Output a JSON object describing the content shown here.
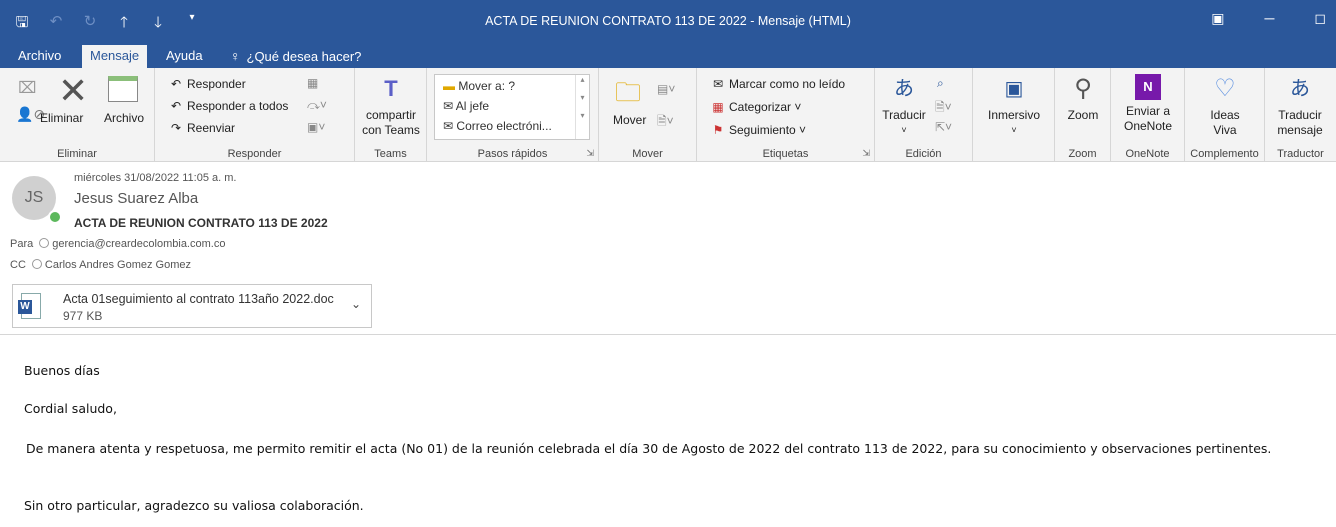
{
  "titlebar": {
    "title": "ACTA DE REUNION CONTRATO 113 DE 2022  -  Mensaje (HTML)",
    "qat": [
      "save-icon",
      "undo-icon",
      "redo-icon",
      "arrow-up-icon",
      "arrow-down-icon",
      "customize-icon"
    ]
  },
  "tabs": {
    "archivo": "Archivo",
    "mensaje": "Mensaje",
    "ayuda": "Ayuda",
    "search": "¿Qué desea hacer?"
  },
  "ribbon": {
    "eliminar": {
      "label": "Eliminar",
      "eliminar_btn": "Eliminar",
      "archivo_btn": "Archivo"
    },
    "responder": {
      "label": "Responder",
      "responder": "Responder",
      "responder_todos": "Responder a todos",
      "reenviar": "Reenviar"
    },
    "teams": {
      "label": "Teams",
      "compartir_line1": "compartir",
      "compartir_line2": "con Teams"
    },
    "pasos": {
      "label": "Pasos rápidos",
      "item1": "Mover a: ?",
      "item2": "Al jefe",
      "item3": "Correo electróni..."
    },
    "mover": {
      "label": "Mover",
      "mover_btn": "Mover"
    },
    "etiquetas": {
      "label": "Etiquetas",
      "marcar": "Marcar como no leído",
      "categorizar": "Categorizar",
      "seguimiento": "Seguimiento"
    },
    "edicion": {
      "label": "Edición",
      "traducir": "Traducir"
    },
    "inmersivo": {
      "label": "",
      "btn": "Inmersivo"
    },
    "zoom": {
      "label": "Zoom",
      "btn": "Zoom"
    },
    "onenote": {
      "label": "OneNote",
      "line1": "Enviar a",
      "line2": "OneNote"
    },
    "complemento": {
      "label": "Complemento",
      "line1": "Ideas",
      "line2": "Viva"
    },
    "traductor": {
      "label": "Traductor",
      "line1": "Traducir",
      "line2": "mensaje"
    }
  },
  "message": {
    "initials": "JS",
    "date": "miércoles 31/08/2022 11:05 a. m.",
    "sender": "Jesus Suarez Alba",
    "subject": "ACTA DE REUNION CONTRATO 113 DE 2022",
    "to_label": "Para",
    "to": "gerencia@creardecolombia.com.co",
    "cc_label": "CC",
    "cc": "Carlos Andres Gomez Gomez",
    "attachment": {
      "name": "Acta 01seguimiento al contrato 113año 2022.doc",
      "size": "977 KB"
    }
  },
  "body": {
    "greeting": "Buenos días",
    "salutation": "Cordial saludo,",
    "paragraph": " De manera atenta y respetuosa,  me permito remitir el acta (No 01) de la reunión celebrada el día 30 de Agosto  de 2022 del contrato 113 de 2022, para su conocimiento y observaciones pertinentes.",
    "closing": "Sin otro particular, agradezco su valiosa colaboración."
  }
}
